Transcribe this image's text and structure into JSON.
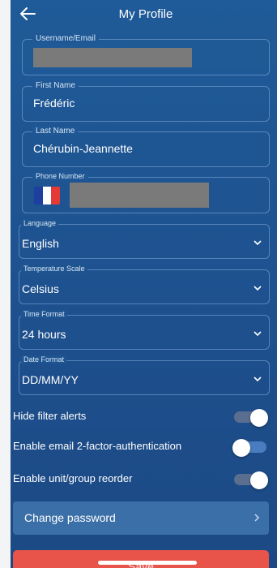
{
  "header": {
    "title": "My Profile"
  },
  "fields": {
    "username": {
      "label": "Username/Email",
      "value": ""
    },
    "first_name": {
      "label": "First Name",
      "value": "Frédéric"
    },
    "last_name": {
      "label": "Last Name",
      "value": "Chérubin-Jeannette"
    },
    "phone": {
      "label": "Phone Number",
      "value": "",
      "country": "France"
    }
  },
  "dropdowns": {
    "language": {
      "label": "Language",
      "value": "English"
    },
    "temperature": {
      "label": "Temperature Scale",
      "value": "Celsius"
    },
    "time_format": {
      "label": "Time Format",
      "value": "24 hours"
    },
    "date_format": {
      "label": "Date Format",
      "value": "DD/MM/YY"
    }
  },
  "toggles": {
    "hide_filter_alerts": {
      "label": "Hide filter alerts",
      "on": true
    },
    "email_2fa": {
      "label": "Enable email 2-factor-authentication",
      "on": false
    },
    "unit_reorder": {
      "label": "Enable unit/group reorder",
      "on": true
    }
  },
  "actions": {
    "change_password": "Change password",
    "save": "Save"
  },
  "colors": {
    "background": "#1e5290",
    "field_border": "#87afdc",
    "button_secondary": "#3b6fa8",
    "button_primary": "#e8534a",
    "toggle_on_track": "#5a6f8f",
    "toggle_off_track": "#4a7cc0"
  },
  "icons": {
    "back": "arrow-left-icon",
    "dropdown": "chevron-down-icon",
    "next": "chevron-right-icon",
    "flag": "france-flag-icon"
  }
}
